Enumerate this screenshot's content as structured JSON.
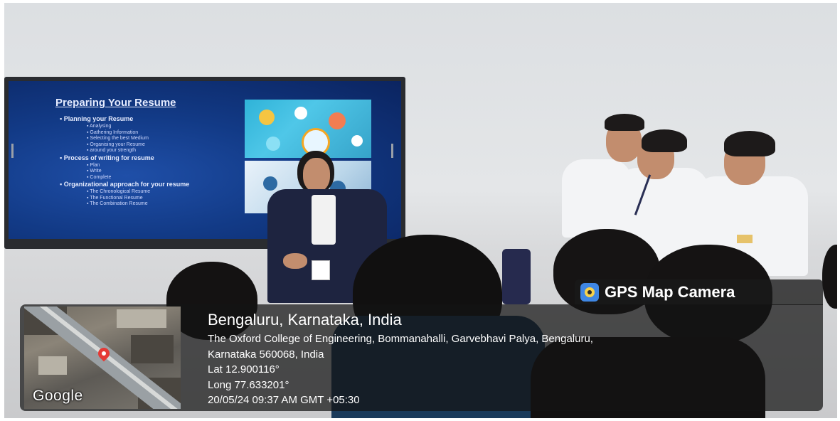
{
  "slide": {
    "title": "Preparing Your Resume",
    "lines": [
      {
        "text": "Planning your Resume",
        "level": 1
      },
      {
        "text": "Analysing",
        "level": 2
      },
      {
        "text": "Gathering Information",
        "level": 2
      },
      {
        "text": "Selecting the best Medium",
        "level": 2
      },
      {
        "text": "Organising your Resume",
        "level": 2
      },
      {
        "text": "around your strength",
        "level": 2
      },
      {
        "text": "Process of writing for resume",
        "level": 1
      },
      {
        "text": "Plan",
        "level": 2
      },
      {
        "text": "Write",
        "level": 2
      },
      {
        "text": "Complete",
        "level": 2
      },
      {
        "text": "Organizational approach for your resume",
        "level": 1
      },
      {
        "text": "The Chronological Resume",
        "level": 2
      },
      {
        "text": "The Functional Resume",
        "level": 2
      },
      {
        "text": "The Combination Resume",
        "level": 2
      }
    ]
  },
  "overlay": {
    "badge": "GPS Map Camera",
    "map_label": "Google",
    "location_title": "Bengaluru, Karnataka, India",
    "address_line1": "The Oxford College of Engineering, Bommanahalli, Garvebhavi Palya, Bengaluru,",
    "address_line2": "Karnataka 560068, India",
    "lat": "Lat 12.900116°",
    "long": "Long 77.633201°",
    "datetime": "20/05/24 09:37 AM GMT +05:30"
  },
  "colors": {
    "slide_bg": "#123a86",
    "panel_bg": "#141414",
    "pin": "#e53935"
  }
}
